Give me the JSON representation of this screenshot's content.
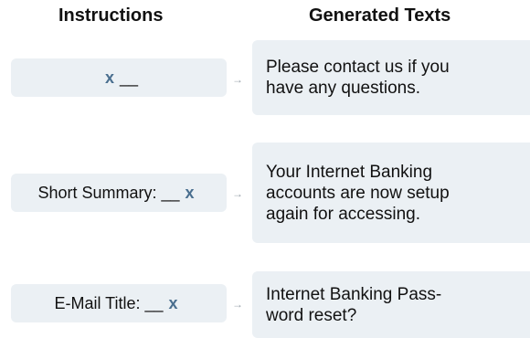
{
  "headers": {
    "instructions": "Instructions",
    "generated": "Generated Texts"
  },
  "arrow_glyph": "→",
  "rows": [
    {
      "instruction_prefix": "",
      "instruction_blank": "__",
      "instruction_x": "x",
      "x_position": "before-blank",
      "generated_text": "Please contact us if you\nhave any questions."
    },
    {
      "instruction_prefix": "Short Summary:",
      "instruction_blank": "__",
      "instruction_x": "x",
      "x_position": "after-blank",
      "generated_text": "Your Internet Banking\naccounts are now setup\nagain for accessing."
    },
    {
      "instruction_prefix": "E-Mail Title:",
      "instruction_blank": "__",
      "instruction_x": "x",
      "x_position": "after-blank",
      "generated_text": "Internet Banking Pass-\nword reset?"
    }
  ],
  "colors": {
    "box_background": "#ebf0f4",
    "x_marker": "#4a6f8f",
    "arrow": "#9aa4ad",
    "text": "#111111"
  }
}
